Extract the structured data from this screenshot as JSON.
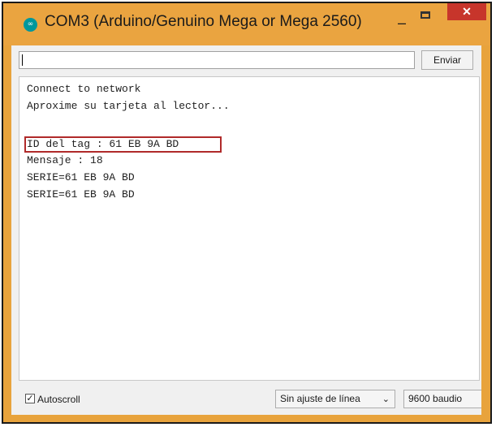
{
  "window": {
    "title": "COM3 (Arduino/Genuino Mega or Mega 2560)",
    "icon": "arduino-icon",
    "icon_glyph": "∞",
    "minimize_glyph": "–",
    "close_glyph": "✕"
  },
  "send": {
    "input_value": "",
    "button_label": "Enviar"
  },
  "output": {
    "lines": [
      "Connect to network",
      "Aproxime su tarjeta al lector...",
      "",
      "ID del tag : 61 EB 9A BD",
      "Mensaje : 18",
      "SERIE=61 EB 9A BD",
      "SERIE=61 EB 9A BD"
    ],
    "highlighted_line": 3
  },
  "footer": {
    "autoscroll_label": "Autoscroll",
    "autoscroll_checked": true,
    "check_glyph": "✓",
    "line_ending_value": "Sin ajuste de línea",
    "dropdown_glyph": "⌄",
    "baud_value": "9600 baudio"
  },
  "colors": {
    "title_bar": "#eaa440",
    "close_button": "#c7352b",
    "highlight_border": "#b02a2a",
    "app_icon": "#00979c"
  }
}
